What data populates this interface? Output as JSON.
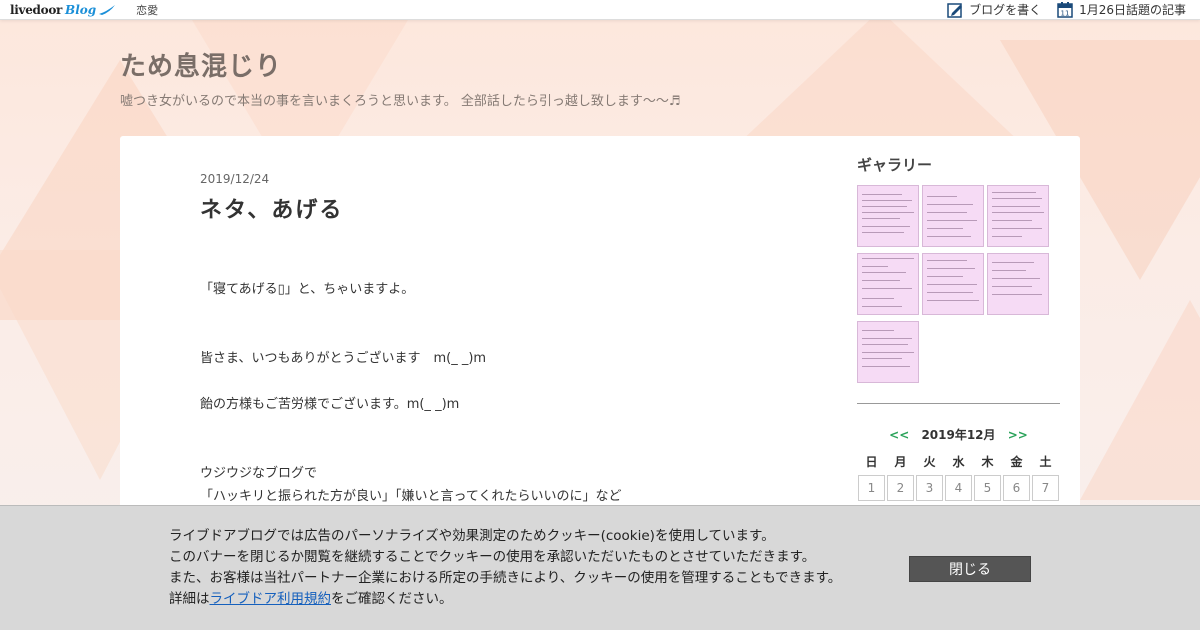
{
  "topbar": {
    "logo_text": "livedoor",
    "logo_blog": "Blog",
    "category": "恋愛",
    "write_blog": "ブログを書く",
    "calendar_day": "11",
    "topic_article": "1月26日話題の記事"
  },
  "header": {
    "title": "ため息混じり",
    "description": "嘘つき女がいるので本当の事を言いまくろうと思います。 全部話したら引っ越し致します〜〜♬"
  },
  "article": {
    "date": "2019/12/24",
    "title": "ネタ、あげる",
    "paragraphs": [
      "「寝てあげる▯」と、ちゃいますよ。",
      "皆さま、いつもありがとうございます　m(_ _)m",
      "飴の方様もご苦労様でございます。m(_ _)m",
      "ウジウジなブログで",
      "「ハッキリと振られた方が良い」「嫌いと言ってくれたらいいのに」など"
    ]
  },
  "sidebar": {
    "gallery_title": "ギャラリー",
    "calendar": {
      "prev": "<<",
      "month": "2019年12月",
      "next": ">>",
      "weekdays": [
        "日",
        "月",
        "火",
        "水",
        "木",
        "金",
        "土"
      ],
      "days": [
        "1",
        "2",
        "3",
        "4",
        "5",
        "6",
        "7"
      ]
    }
  },
  "cookie": {
    "line1": "ライブドアブログでは広告のパーソナライズや効果測定のためクッキー(cookie)を使用しています。",
    "line2": "このバナーを閉じるか閲覧を継続することでクッキーの使用を承認いただいたものとさせていただきます。",
    "line3": "また、お客様は当社パートナー企業における所定の手続きにより、クッキーの使用を管理することもできます。",
    "line4_prefix": "詳細は",
    "line4_link": "ライブドア利用規約",
    "line4_suffix": "をご確認ください。",
    "close_label": "閉じる"
  },
  "colors": {
    "accent_green": "#2aa35a",
    "link_blue": "#1560bd",
    "close_button": "#555555"
  }
}
